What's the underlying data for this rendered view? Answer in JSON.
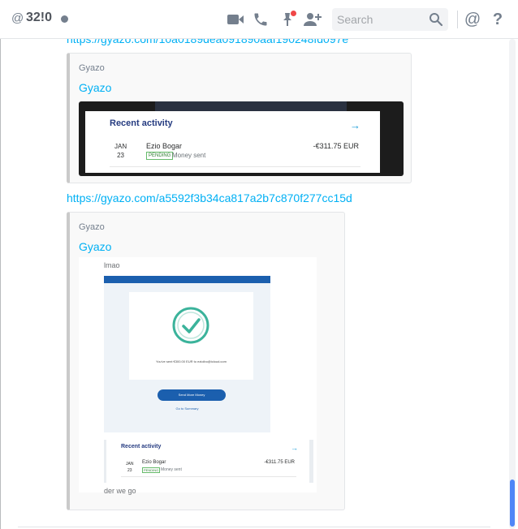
{
  "header": {
    "at_symbol": "@",
    "username": "32!0",
    "status": "offline",
    "icons": [
      "video-call-icon",
      "phone-call-icon",
      "pinned-messages-icon",
      "add-friend-icon",
      "search-icon",
      "mentions-icon",
      "help-icon"
    ],
    "search_placeholder": "Search",
    "mentions_label": "@",
    "help_label": "?"
  },
  "messages": {
    "partial_link": "https://gyazo.com/10a0189dea091890aaf190248fd097e",
    "embed1": {
      "provider": "Gyazo",
      "title": "Gyazo",
      "image": {
        "heading": "Recent activity",
        "arrow": "→",
        "date_month": "JAN",
        "date_day": "23",
        "name": "Ezio Bogar",
        "badge": "PENDING",
        "status": "Money sent",
        "amount": "-€311.75 EUR"
      }
    },
    "link2": "https://gyazo.com/a5592f3b34ca817a2b7c870f277cc15d",
    "embed2": {
      "provider": "Gyazo",
      "title": "Gyazo",
      "image": {
        "caption_top": "lmao",
        "sent_message": "You've sent €300.00 EUR to ezioibo@icloud.com",
        "send_button": "Send More Money",
        "summary_link": "Go to Summary",
        "heading": "Recent activity",
        "arrow": "→",
        "date_month": "JAN",
        "date_day": "23",
        "name": "Ezio Bogar",
        "badge": "PENDING",
        "status": "Money sent",
        "amount": "-€311.75 EUR",
        "caption_bottom": "der we go"
      }
    }
  },
  "colors": {
    "link": "#00b0f4",
    "notification_badge": "#f04747",
    "embed_border": "#cacaca",
    "scroll_thumb": "#4f86f7",
    "paypal_navy": "#253b80",
    "paypal_blue": "#1b5fae",
    "success_teal": "#3bb39b"
  }
}
